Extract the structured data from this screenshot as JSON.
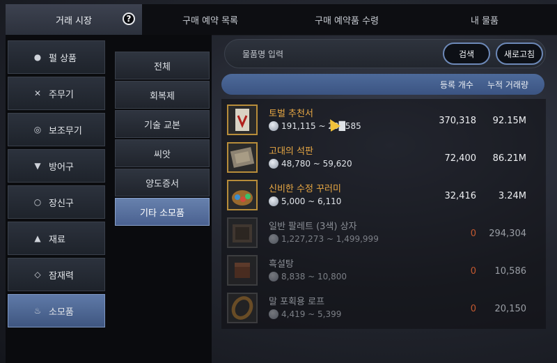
{
  "tabs": [
    {
      "label": "거래 시장"
    },
    {
      "label": "구매 예약 목록"
    },
    {
      "label": "구매 예약품 수령"
    },
    {
      "label": "내 물품"
    }
  ],
  "help_label": "?",
  "categories": [
    {
      "label": "펄 상품",
      "icon": "pearl-icon",
      "glyph": "●"
    },
    {
      "label": "주무기",
      "icon": "crossed-swords-icon",
      "glyph": "✕"
    },
    {
      "label": "보조무기",
      "icon": "target-icon",
      "glyph": "◎"
    },
    {
      "label": "방어구",
      "icon": "armor-icon",
      "glyph": "▼"
    },
    {
      "label": "장신구",
      "icon": "ring-icon",
      "glyph": "○"
    },
    {
      "label": "재료",
      "icon": "flask-icon",
      "glyph": "▲"
    },
    {
      "label": "잠재력",
      "icon": "diamond-icon",
      "glyph": "◇"
    },
    {
      "label": "소모품",
      "icon": "potion-icon",
      "glyph": "♨"
    }
  ],
  "subcategories": [
    {
      "label": "전체"
    },
    {
      "label": "회복제"
    },
    {
      "label": "기술 교본"
    },
    {
      "label": "씨앗"
    },
    {
      "label": "양도증서"
    },
    {
      "label": "기타 소모품"
    }
  ],
  "search": {
    "placeholder": "물품명 입력",
    "button_label": "검색",
    "refresh_label": "새로고침"
  },
  "table_header": {
    "count_label": "등록 개수",
    "volume_label": "누적 거래량"
  },
  "items": [
    {
      "name": "토벌 추천서",
      "price": "191,115 ~ 23█585",
      "count": "370,318",
      "volume": "92.15M",
      "icon": "scroll-icon",
      "dim": false
    },
    {
      "name": "고대의 석판",
      "price": "48,780 ~ 59,620",
      "count": "72,400",
      "volume": "86.21M",
      "icon": "stone-tablet-icon",
      "dim": false
    },
    {
      "name": "신비한 수정 꾸러미",
      "price": "5,000 ~ 6,110",
      "count": "32,416",
      "volume": "3.24M",
      "icon": "crystal-bundle-icon",
      "dim": false
    },
    {
      "name": "일반 팔레트 (3색) 상자",
      "price": "1,227,273 ~ 1,499,999",
      "count": "0",
      "volume": "294,304",
      "icon": "palette-box-icon",
      "dim": true
    },
    {
      "name": "흑설탕",
      "price": "8,838 ~ 10,800",
      "count": "0",
      "volume": "10,586",
      "icon": "sugar-cube-icon",
      "dim": true
    },
    {
      "name": "말 포획용 로프",
      "price": "4,419 ~ 5,399",
      "count": "0",
      "volume": "20,150",
      "icon": "rope-icon",
      "dim": true
    }
  ],
  "colors": {
    "accent": "#5f7aa8",
    "item_name": "#e8a844",
    "zero_count": "#c4592f"
  }
}
